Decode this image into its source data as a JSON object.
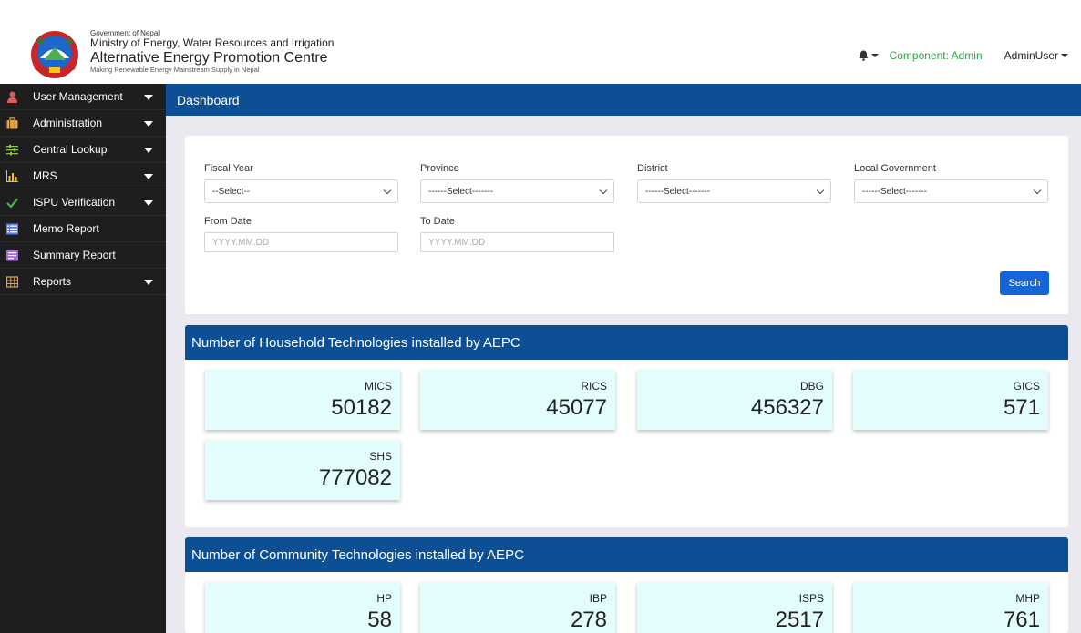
{
  "header": {
    "gov": "Government of Nepal",
    "ministry": "Ministry of Energy, Water Resources and Irrigation",
    "centre": "Alternative Energy Promotion Centre",
    "tagline": "Making Renewable Energy Mainstream Supply in Nepal",
    "component_label": "Component:",
    "component_value": "Admin",
    "user": "AdminUser"
  },
  "sidebar": {
    "items": [
      {
        "label": "User Management",
        "icon": "user-icon",
        "color": "#e05a5a"
      },
      {
        "label": "Administration",
        "icon": "briefcase-icon",
        "color": "#e8a33c"
      },
      {
        "label": "Central Lookup",
        "icon": "sliders-icon",
        "color": "#8bc34a"
      },
      {
        "label": "MRS",
        "icon": "bar-chart-icon",
        "color": "#f5c518"
      },
      {
        "label": "ISPU Verification",
        "icon": "check-icon",
        "color": "#4caf50"
      },
      {
        "label": "Memo Report",
        "icon": "list-icon",
        "color": "#5b7ce6"
      },
      {
        "label": "Summary Report",
        "icon": "document-icon",
        "color": "#a86ad8"
      },
      {
        "label": "Reports",
        "icon": "table-icon",
        "color": "#e8a33c"
      }
    ]
  },
  "page": {
    "title": "Dashboard"
  },
  "filters": {
    "fiscal_year": {
      "label": "Fiscal Year",
      "value": "--Select--"
    },
    "province": {
      "label": "Province",
      "value": "------Select-------"
    },
    "district": {
      "label": "District",
      "value": "------Select-------"
    },
    "local_government": {
      "label": "Local Government",
      "value": "------Select-------"
    },
    "from_date": {
      "label": "From Date",
      "placeholder": "YYYY.MM.DD"
    },
    "to_date": {
      "label": "To Date",
      "placeholder": "YYYY.MM.DD"
    },
    "search_label": "Search"
  },
  "household": {
    "title": "Number of Household Technologies installed by AEPC",
    "stats": [
      {
        "label": "MICS",
        "value": "50182"
      },
      {
        "label": "RICS",
        "value": "45077"
      },
      {
        "label": "DBG",
        "value": "456327"
      },
      {
        "label": "GICS",
        "value": "571"
      },
      {
        "label": "SHS",
        "value": "777082"
      }
    ]
  },
  "community": {
    "title": "Number of Community Technologies installed by AEPC",
    "stats": [
      {
        "label": "HP",
        "value": "58"
      },
      {
        "label": "IBP",
        "value": "278"
      },
      {
        "label": "ISPS",
        "value": "2517"
      },
      {
        "label": "MHP",
        "value": "761"
      }
    ]
  }
}
